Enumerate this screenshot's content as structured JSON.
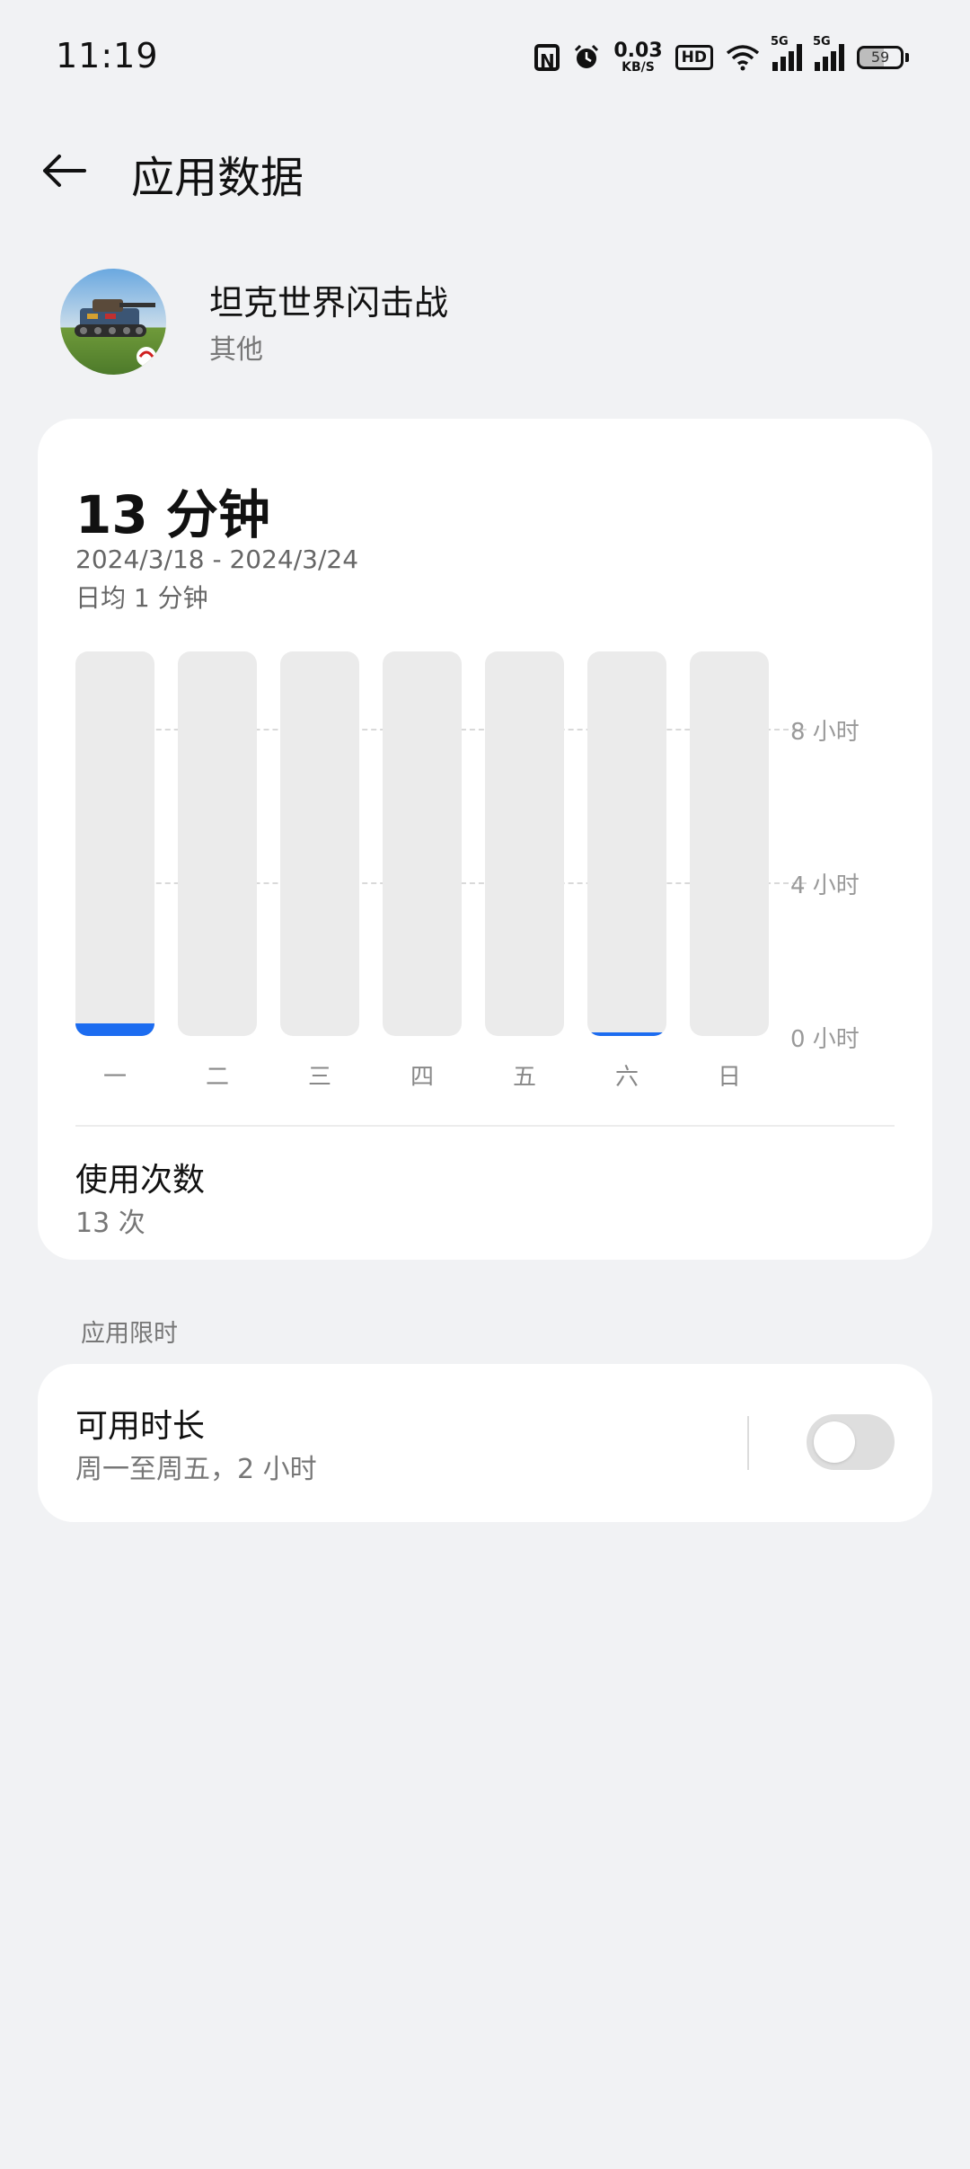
{
  "status_bar": {
    "time": "11:19",
    "net_speed_value": "0.03",
    "net_speed_unit": "KB/S",
    "hd_label": "HD",
    "signal1_label": "5G",
    "signal2_label": "5G",
    "battery_level": "59",
    "icons": [
      "nfc-icon",
      "alarm-icon",
      "hd-icon",
      "wifi-icon",
      "signal-icon",
      "signal-icon",
      "battery-icon"
    ]
  },
  "header": {
    "title": "应用数据",
    "back_icon": "arrow-left-icon"
  },
  "app": {
    "name": "坦克世界闪击战",
    "category": "其他"
  },
  "usage": {
    "total": "13 分钟",
    "date_range": "2024/3/18 - 2024/3/24",
    "daily_avg": "日均 1 分钟"
  },
  "chart_data": {
    "type": "bar",
    "categories": [
      "一",
      "二",
      "三",
      "四",
      "五",
      "六",
      "日"
    ],
    "values": [
      12,
      0,
      0,
      0,
      0,
      1,
      0
    ],
    "unit": "分钟",
    "y_tick_labels": [
      "0 小时",
      "4 小时",
      "8 小时"
    ],
    "y_ticks_minutes": [
      0,
      240,
      480
    ],
    "ylim_minutes": [
      0,
      600
    ],
    "colors": {
      "fill": "#1c6cf0",
      "track": "#ebebeb"
    }
  },
  "launches": {
    "label": "使用次数",
    "value": "13 次"
  },
  "limits": {
    "section_label": "应用限时",
    "item_label": "可用时长",
    "item_value": "周一至周五，2 小时",
    "toggle_on": false
  }
}
